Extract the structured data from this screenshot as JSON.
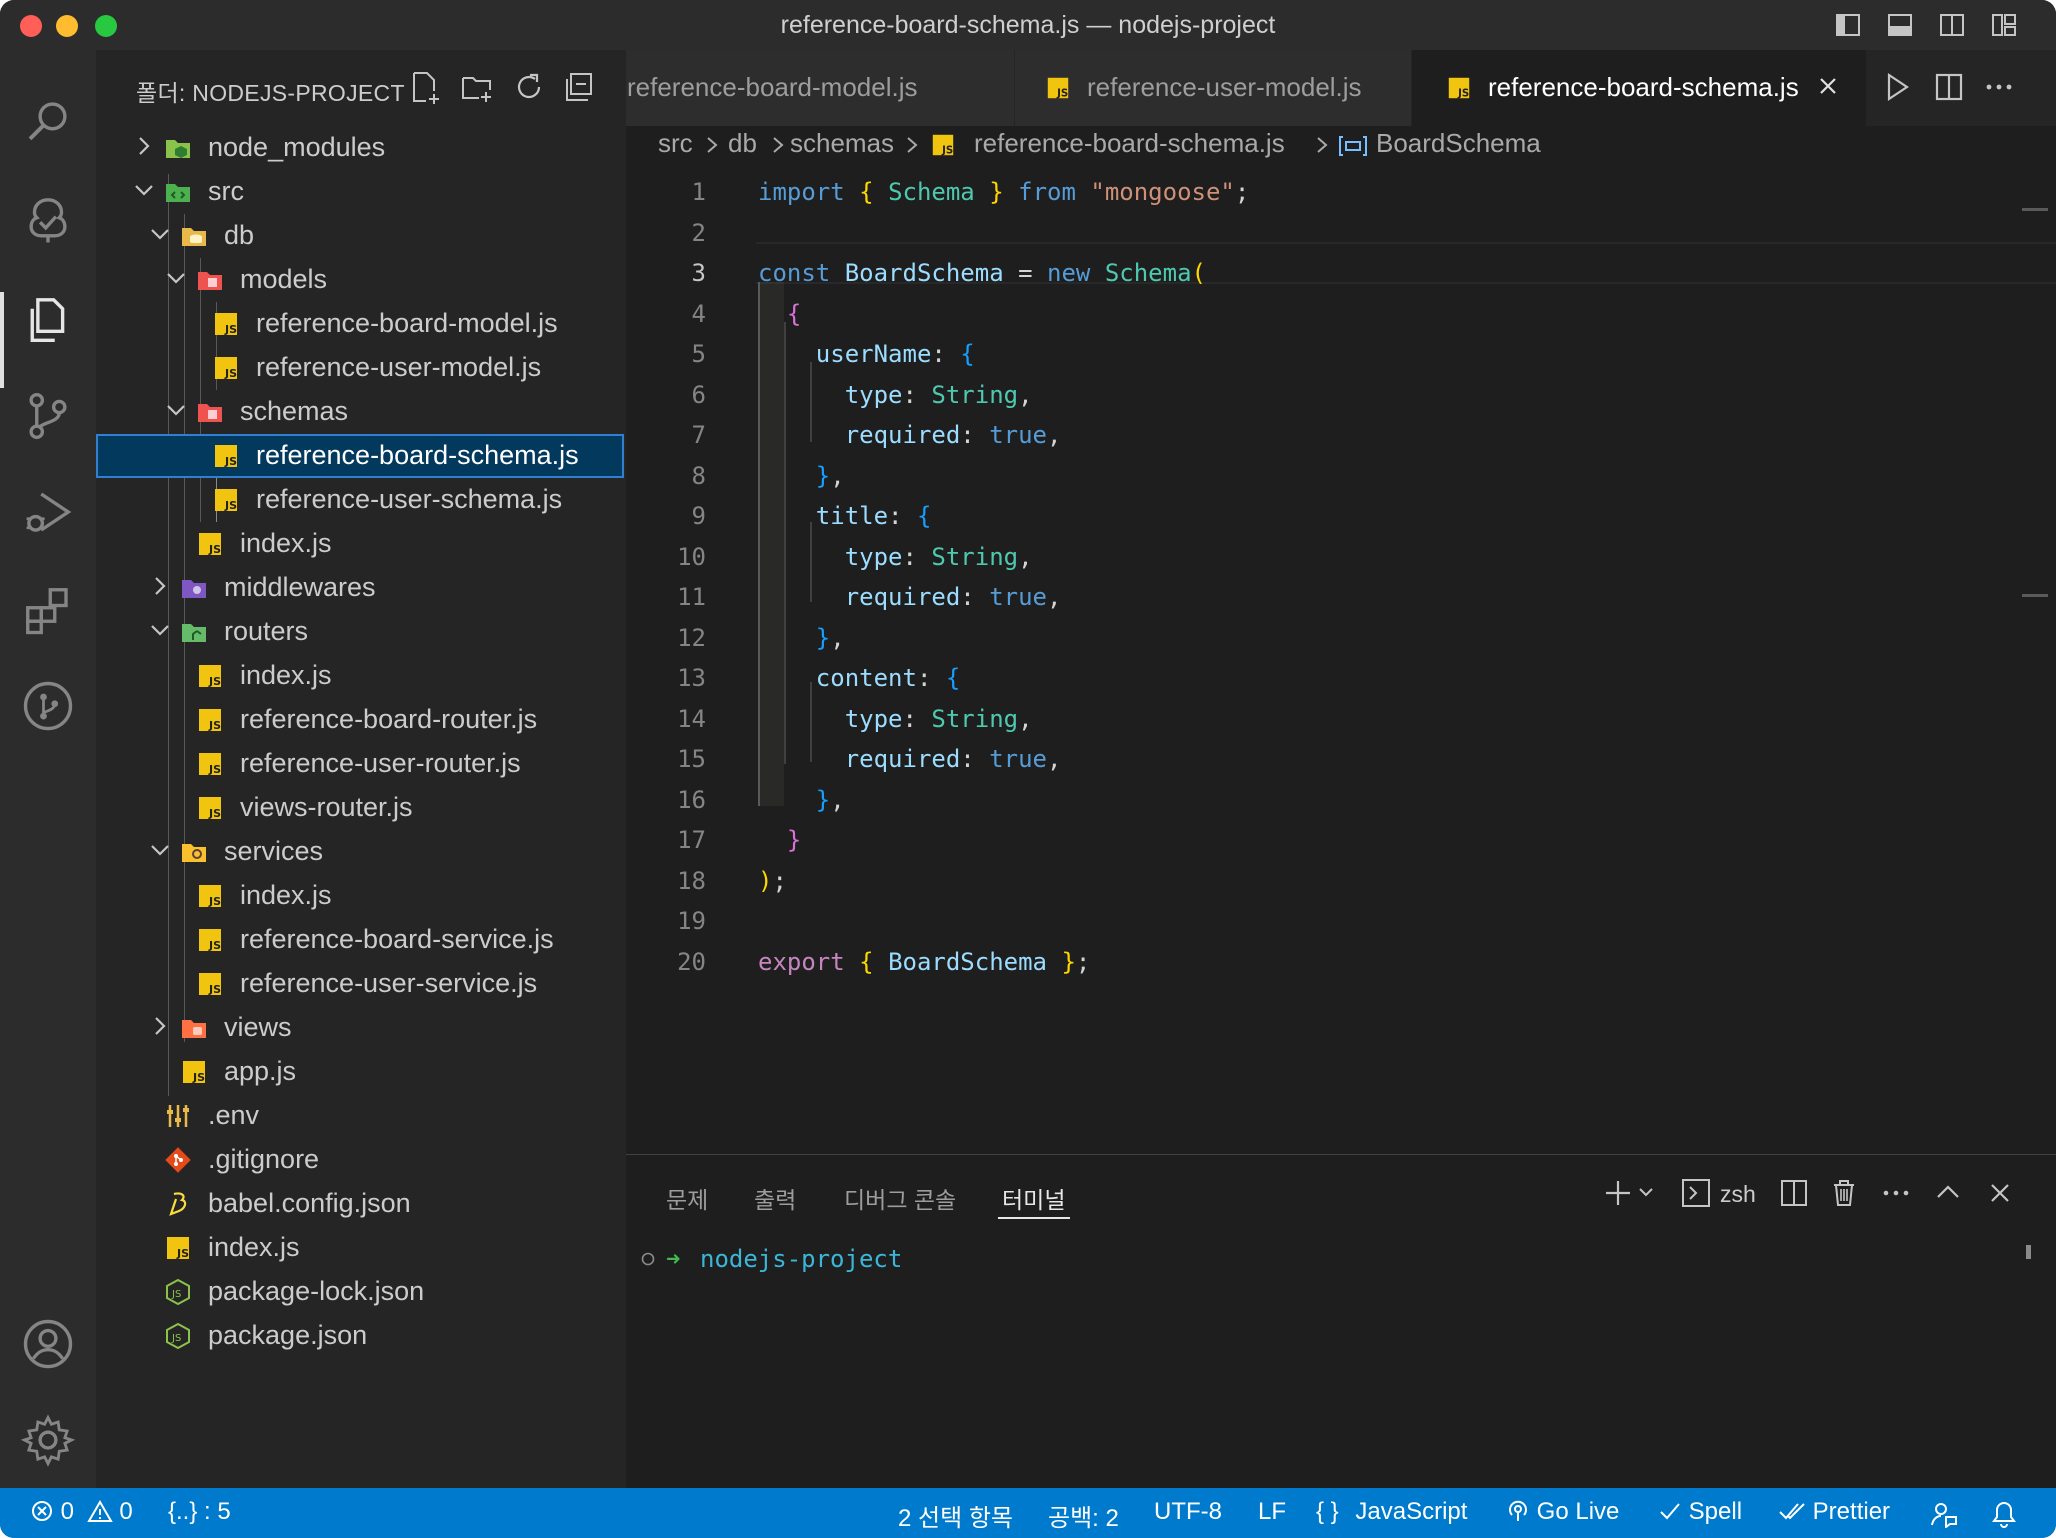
{
  "window": {
    "title": "reference-board-schema.js — nodejs-project"
  },
  "colors": {
    "accent": "#007acc",
    "selection": "#04395e",
    "folder_db": "#e8b84a",
    "js_icon": "#f1c40f"
  },
  "activity_bar": {
    "items": [
      "search-icon",
      "remote-explorer-icon",
      "explorer-icon",
      "source-control-icon",
      "run-debug-icon",
      "extensions-icon",
      "git-graph-icon"
    ],
    "bottom": [
      "account-icon",
      "settings-gear-icon"
    ]
  },
  "sidebar": {
    "title": "폴더: NODEJS-PROJECT",
    "tree": [
      {
        "label": "node_modules"
      },
      {
        "label": "src"
      },
      {
        "label": "db"
      },
      {
        "label": "models"
      },
      {
        "label": "reference-board-model.js"
      },
      {
        "label": "reference-user-model.js"
      },
      {
        "label": "schemas"
      },
      {
        "label": "reference-board-schema.js"
      },
      {
        "label": "reference-user-schema.js"
      },
      {
        "label": "index.js"
      },
      {
        "label": "middlewares"
      },
      {
        "label": "routers"
      },
      {
        "label": "index.js"
      },
      {
        "label": "reference-board-router.js"
      },
      {
        "label": "reference-user-router.js"
      },
      {
        "label": "views-router.js"
      },
      {
        "label": "services"
      },
      {
        "label": "index.js"
      },
      {
        "label": "reference-board-service.js"
      },
      {
        "label": "reference-user-service.js"
      },
      {
        "label": "views"
      },
      {
        "label": "app.js"
      },
      {
        "label": ".env"
      },
      {
        "label": ".gitignore"
      },
      {
        "label": "babel.config.json"
      },
      {
        "label": "index.js"
      },
      {
        "label": "package-lock.json"
      },
      {
        "label": "package.json"
      }
    ]
  },
  "tabs": [
    {
      "label": "reference-board-model.js"
    },
    {
      "label": "reference-user-model.js"
    },
    {
      "label": "reference-board-schema.js"
    }
  ],
  "breadcrumb": [
    "src",
    "db",
    "schemas",
    "reference-board-schema.js",
    "BoardSchema"
  ],
  "editor": {
    "current_line": 3,
    "line_numbers": [
      "1",
      "2",
      "3",
      "4",
      "5",
      "6",
      "7",
      "8",
      "9",
      "10",
      "11",
      "12",
      "13",
      "14",
      "15",
      "16",
      "17",
      "18",
      "19",
      "20"
    ],
    "lines": [
      [
        [
          "kw",
          "import"
        ],
        [
          "pun",
          " "
        ],
        [
          "br1",
          "{"
        ],
        [
          "pun",
          " "
        ],
        [
          "cls",
          "Schema"
        ],
        [
          "pun",
          " "
        ],
        [
          "br1",
          "}"
        ],
        [
          "pun",
          " "
        ],
        [
          "kw",
          "from"
        ],
        [
          "pun",
          " "
        ],
        [
          "str",
          "\"mongoose\""
        ],
        [
          "pun",
          ";"
        ]
      ],
      [],
      [
        [
          "kw",
          "const"
        ],
        [
          "pun",
          " "
        ],
        [
          "var",
          "BoardSchema"
        ],
        [
          "pun",
          " = "
        ],
        [
          "kw",
          "new"
        ],
        [
          "pun",
          " "
        ],
        [
          "cls",
          "Schema"
        ],
        [
          "br1",
          "("
        ]
      ],
      [
        [
          "pun",
          "  "
        ],
        [
          "br2",
          "{"
        ]
      ],
      [
        [
          "pun",
          "    "
        ],
        [
          "var",
          "userName"
        ],
        [
          "pun",
          ": "
        ],
        [
          "br3",
          "{"
        ]
      ],
      [
        [
          "pun",
          "      "
        ],
        [
          "var",
          "type"
        ],
        [
          "pun",
          ": "
        ],
        [
          "cls",
          "String"
        ],
        [
          "pun",
          ","
        ]
      ],
      [
        [
          "pun",
          "      "
        ],
        [
          "var",
          "required"
        ],
        [
          "pun",
          ": "
        ],
        [
          "bool",
          "true"
        ],
        [
          "pun",
          ","
        ]
      ],
      [
        [
          "pun",
          "    "
        ],
        [
          "br3",
          "}"
        ],
        [
          "pun",
          ","
        ]
      ],
      [
        [
          "pun",
          "    "
        ],
        [
          "var",
          "title"
        ],
        [
          "pun",
          ": "
        ],
        [
          "br3",
          "{"
        ]
      ],
      [
        [
          "pun",
          "      "
        ],
        [
          "var",
          "type"
        ],
        [
          "pun",
          ": "
        ],
        [
          "cls",
          "String"
        ],
        [
          "pun",
          ","
        ]
      ],
      [
        [
          "pun",
          "      "
        ],
        [
          "var",
          "required"
        ],
        [
          "pun",
          ": "
        ],
        [
          "bool",
          "true"
        ],
        [
          "pun",
          ","
        ]
      ],
      [
        [
          "pun",
          "    "
        ],
        [
          "br3",
          "}"
        ],
        [
          "pun",
          ","
        ]
      ],
      [
        [
          "pun",
          "    "
        ],
        [
          "var",
          "content"
        ],
        [
          "pun",
          ": "
        ],
        [
          "br3",
          "{"
        ]
      ],
      [
        [
          "pun",
          "      "
        ],
        [
          "var",
          "type"
        ],
        [
          "pun",
          ": "
        ],
        [
          "cls",
          "String"
        ],
        [
          "pun",
          ","
        ]
      ],
      [
        [
          "pun",
          "      "
        ],
        [
          "var",
          "required"
        ],
        [
          "pun",
          ": "
        ],
        [
          "bool",
          "true"
        ],
        [
          "pun",
          ","
        ]
      ],
      [
        [
          "pun",
          "    "
        ],
        [
          "br3",
          "}"
        ],
        [
          "pun",
          ","
        ]
      ],
      [
        [
          "pun",
          "  "
        ],
        [
          "br2",
          "}"
        ]
      ],
      [
        [
          "br1",
          ")"
        ],
        [
          "pun",
          ";"
        ]
      ],
      [],
      [
        [
          "ctl",
          "export"
        ],
        [
          "pun",
          " "
        ],
        [
          "br1",
          "{"
        ],
        [
          "pun",
          " "
        ],
        [
          "var",
          "BoardSchema"
        ],
        [
          "pun",
          " "
        ],
        [
          "br1",
          "}"
        ],
        [
          "pun",
          ";"
        ]
      ]
    ]
  },
  "panel": {
    "tabs": [
      "문제",
      "출력",
      "디버그 콘솔",
      "터미널"
    ],
    "active_tab": "터미널",
    "shell": "zsh",
    "terminal_prompt": "nodejs-project"
  },
  "status": {
    "errors": "0",
    "warnings": "0",
    "bracket_info": "{..} : 5",
    "selection": "2 선택 항목",
    "spaces": "공백: 2",
    "encoding": "UTF-8",
    "eol": "LF",
    "language_braces": "{ }",
    "language": "JavaScript",
    "go_live": "Go Live",
    "spell": "Spell",
    "prettier": "Prettier"
  }
}
